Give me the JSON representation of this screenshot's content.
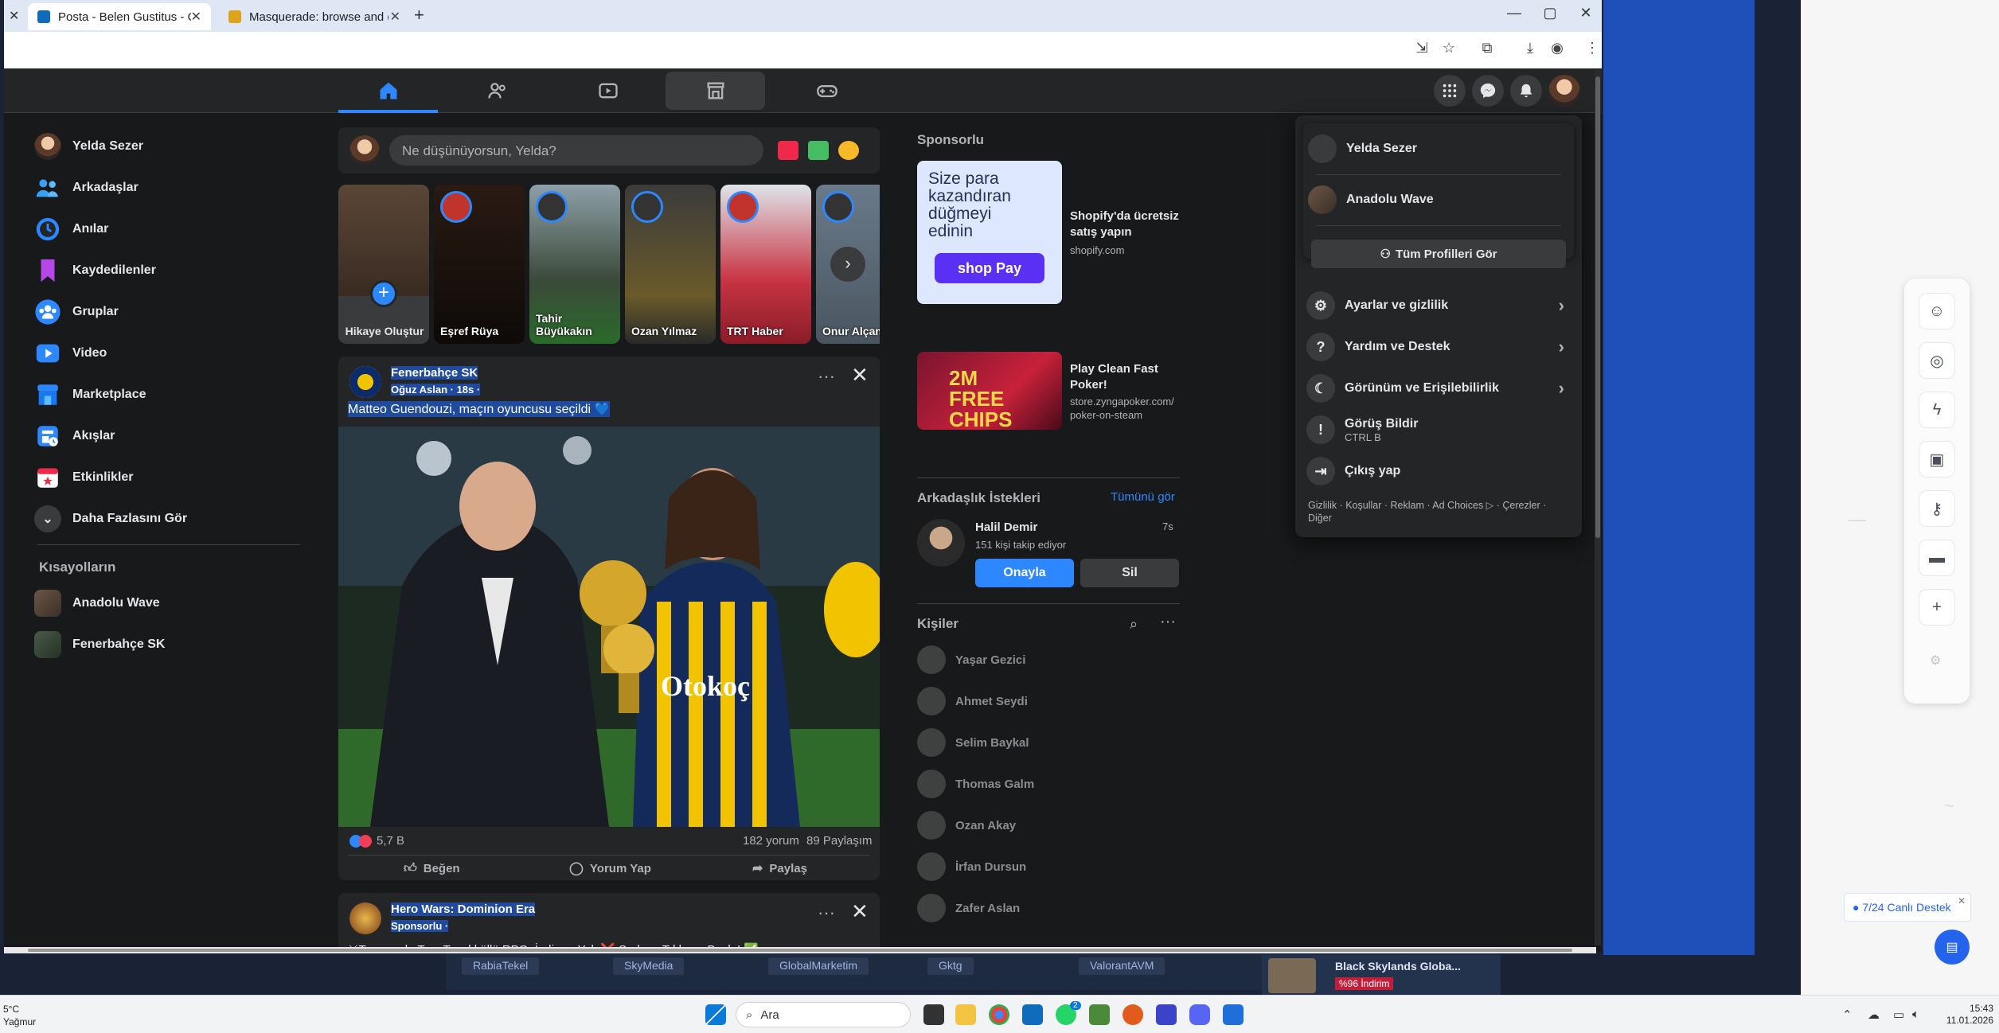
{
  "browser": {
    "tabs": [
      {
        "label": "Posta - Belen Gustitus - Outlook"
      },
      {
        "label": "Masquerade: browse and down"
      }
    ]
  },
  "sidebar": {
    "user_name": "Yelda Sezer",
    "items": [
      {
        "label": "Arkadaşlar",
        "icon": "friends-icon"
      },
      {
        "label": "Anılar",
        "icon": "memories-icon"
      },
      {
        "label": "Kaydedilenler",
        "icon": "bookmark-icon"
      },
      {
        "label": "Gruplar",
        "icon": "groups-icon"
      },
      {
        "label": "Video",
        "icon": "video-icon"
      },
      {
        "label": "Marketplace",
        "icon": "marketplace-icon"
      },
      {
        "label": "Akışlar",
        "icon": "feeds-icon"
      },
      {
        "label": "Etkinlikler",
        "icon": "calendar-icon"
      }
    ],
    "see_more": "Daha Fazlasını Gör",
    "shortcuts_title": "Kısayolların",
    "shortcuts": [
      {
        "label": "Anadolu Wave"
      },
      {
        "label": "Fenerbahçe SK"
      }
    ]
  },
  "composer": {
    "placeholder": "Ne düşünüyorsun, Yelda?"
  },
  "stories": [
    {
      "label": "Hikaye Oluştur"
    },
    {
      "label": "Eşref Rüya"
    },
    {
      "label": "Tahir Büyükakın"
    },
    {
      "label": "Ozan Yılmaz"
    },
    {
      "label": "TRT Haber"
    },
    {
      "label": "Onur Alçam"
    }
  ],
  "post1": {
    "page_name": "Fenerbahçe SK",
    "author_time": "Oğuz Aslan · 18s · ",
    "text": "Matteo Guendouzi, maçın oyuncusu seçildi 💙",
    "reactions": "5,7 B",
    "comments": "182 yorum",
    "shares": "89 Paylaşım",
    "like_label": "Beğen",
    "comment_label": "Yorum Yap",
    "share_label": "Paylaş",
    "shirt_text": "Otokoç"
  },
  "post2": {
    "page_name": "Hero Wars: Dominion Era",
    "sponsored": "Sponsorlu · ",
    "text": "⚔Taravanda Tam Teşekküllü RPG: İndirme Yok ❌ Sadece Tıkla ve Başla! ✅"
  },
  "right": {
    "sponsored_title": "Sponsorlu",
    "ads": [
      {
        "title": "Shopify'da ücretsiz satış yapın",
        "url": "shopify.com",
        "image_text": "Size para kazandıran düğmeyi edinin",
        "button_text": "shop Pay"
      },
      {
        "title": "Play Clean Fast Poker!",
        "url": "store.zyngapoker.com/ poker-on-steam",
        "image_text": "2M FREE CHIPS"
      }
    ],
    "requests_title": "Arkadaşlık İstekleri",
    "see_all": "Tümünü gör",
    "request": {
      "name": "Halil Demir",
      "time": "7s",
      "meta": "151 kişi takip ediyor",
      "confirm": "Onayla",
      "delete": "Sil"
    },
    "people_title": "Kişiler",
    "contacts": [
      "Yaşar Gezici",
      "Ahmet Seydi",
      "Selim Baykal",
      "Thomas Galm",
      "Ozan Akay",
      "İrfan Dursun",
      "Zafer Aslan"
    ]
  },
  "account_menu": {
    "profile_name": "Yelda Sezer",
    "page_name": "Anadolu Wave",
    "all_profiles": "Tüm Profilleri Gör",
    "items": [
      {
        "label": "Ayarlar ve gizlilik",
        "icon": "gear-icon"
      },
      {
        "label": "Yardım ve Destek",
        "icon": "help-icon"
      },
      {
        "label": "Görünüm ve Erişilebilirlik",
        "icon": "moon-icon"
      }
    ],
    "feedback": "Görüş Bildir",
    "feedback_shortcut": "CTRL B",
    "logout": "Çıkış yap",
    "footer": "Gizlilik · Koşullar · Reklam · Ad Choices ▷ · Çerezler · Diğer"
  },
  "behind": {
    "strip_items": [
      "RabiaTekel",
      "SkyMedia",
      "GlobalMarketim",
      "Gktg",
      "ValorantAVM"
    ],
    "card_title": "Black Skylands Globa...",
    "card_badge": "%96 İndirim"
  },
  "widget": {
    "canli_destek": "● 7/24 Canlı Destek"
  },
  "taskbar": {
    "weather_temp": "5°C",
    "weather_desc": "Yağmur",
    "search": "Ara",
    "time": "15:43",
    "date": "11.01.2026",
    "badge_count": "2"
  },
  "colors": {
    "fb_blue": "#2d88ff",
    "fb_bg": "#18191a",
    "card_bg": "#242526",
    "highlight": "#1f4a9e"
  }
}
